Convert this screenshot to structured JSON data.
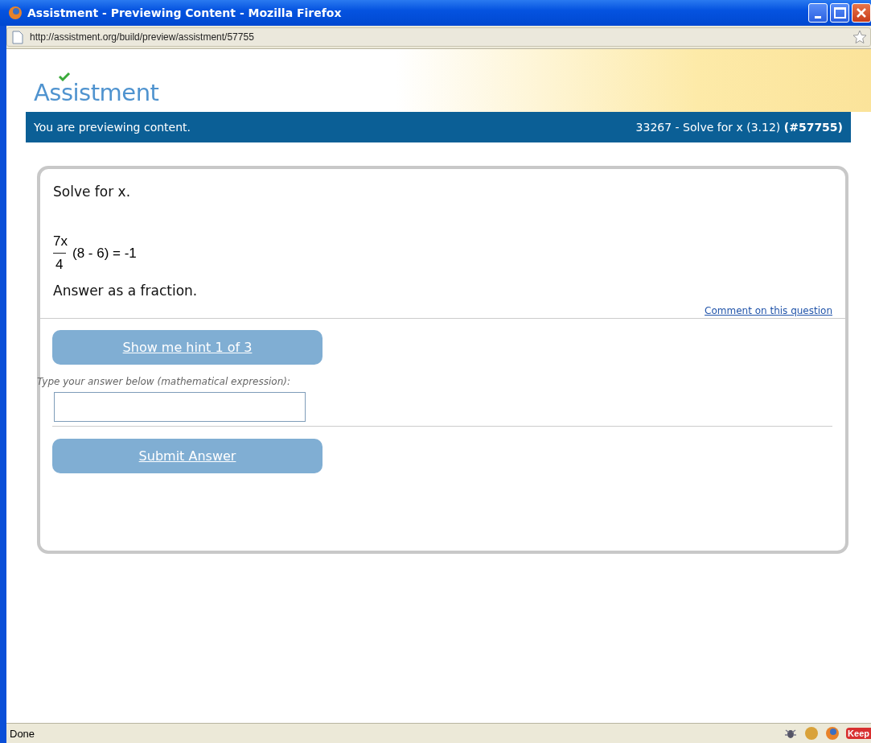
{
  "window": {
    "title": "Assistment - Previewing Content - Mozilla Firefox"
  },
  "address_bar": {
    "url": "http://assistment.org/build/preview/assistment/57755"
  },
  "header": {
    "logo": "Assistment"
  },
  "banner": {
    "left": "You are previewing content.",
    "right": "33267 - Solve for x (3.12) **(#57755)**"
  },
  "question": {
    "prompt": "Solve for x.",
    "equation": {
      "numerator": "7x",
      "denominator": "4",
      "rest": "(8 - 6) = -1"
    },
    "instruction": "Answer as a fraction.",
    "comment_link": "Comment on this question"
  },
  "hint_button": "Show me hint 1 of 3",
  "answer": {
    "label": "Type your answer below (mathematical expression):"
  },
  "submit_button": "Submit Answer",
  "status_bar": {
    "text": "Done",
    "badge": "Keep"
  }
}
